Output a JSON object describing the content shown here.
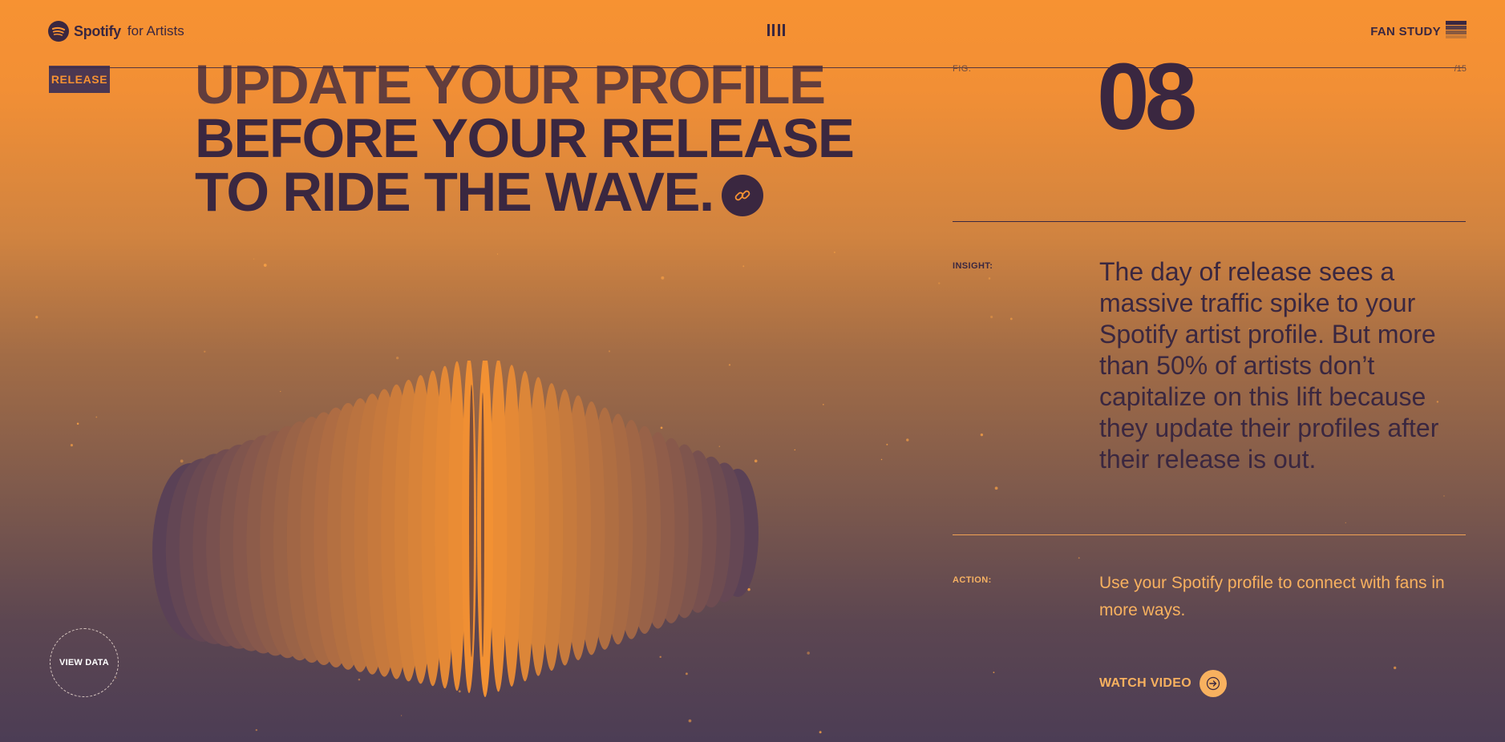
{
  "header": {
    "brand": "Spotify",
    "brand_suffix": "for Artists",
    "fan_study_label": "FAN STUDY"
  },
  "badge": "RELEASE",
  "headline": {
    "lines": [
      "UPDATE YOUR PROFILE",
      "BEFORE YOUR RELEASE",
      "TO RIDE THE WAVE."
    ]
  },
  "fig": {
    "label": "FIG.",
    "number": "08",
    "total": "/15"
  },
  "insight": {
    "label": "INSIGHT:",
    "text": "The day of release sees a massive traffic spike to your Spotify artist profile. But more than 50% of artists don’t capitalize on this lift because they update their profiles after their release is out."
  },
  "action": {
    "label": "ACTION:",
    "text": "Use your Spotify profile to connect with fans in more ways.",
    "watch_label": "WATCH VIDEO"
  },
  "view_data_label": "VIEW DATA",
  "colors": {
    "orange": "#f79232",
    "plum": "#3a2740",
    "light_orange": "#f8b15f",
    "bottom_purple": "#4c3d55"
  },
  "icons": {
    "menu": "menu-bars-icon",
    "fan_study": "stack-icon",
    "link": "link-icon",
    "watch": "arrow-right-icon"
  }
}
